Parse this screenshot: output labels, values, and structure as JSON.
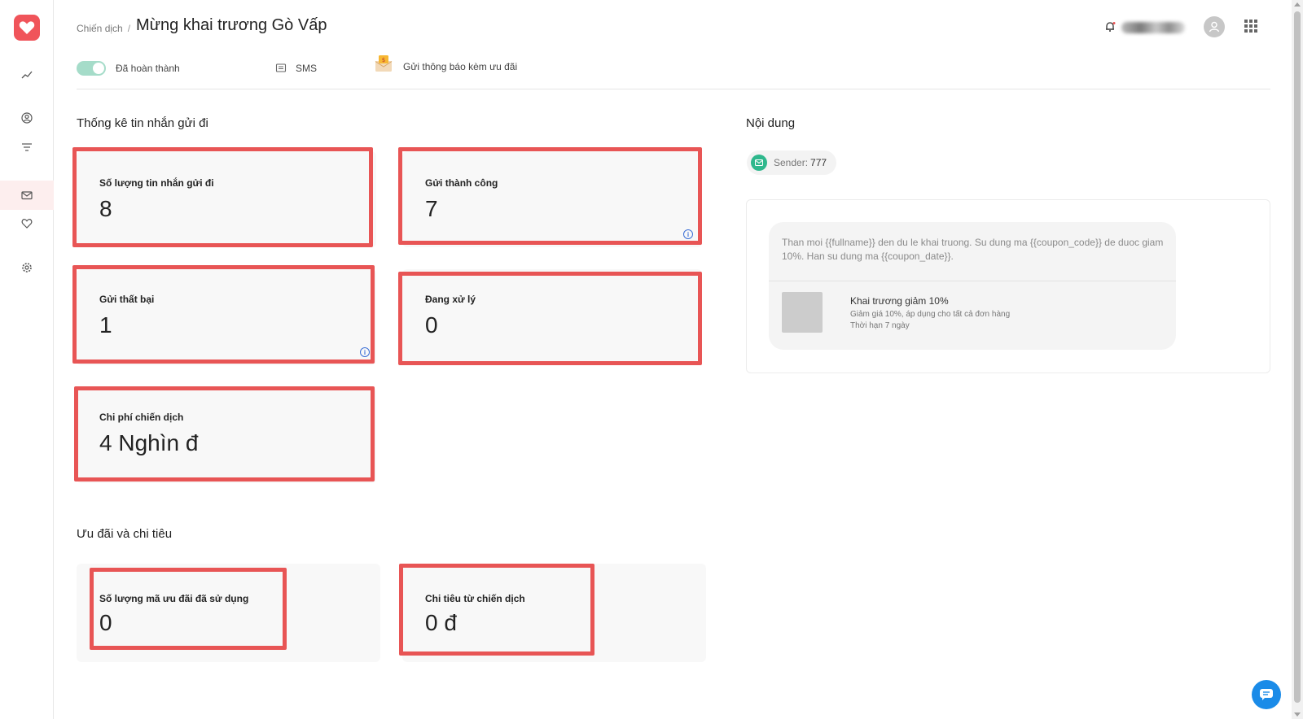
{
  "sidebar": {
    "items": [
      {
        "name": "analytics",
        "icon": "chart-line-icon"
      },
      {
        "name": "customers",
        "icon": "user-circle-icon"
      },
      {
        "name": "filters",
        "icon": "filter-icon"
      },
      {
        "name": "messages",
        "icon": "mail-icon",
        "active": true
      },
      {
        "name": "loyalty",
        "icon": "heart-icon"
      },
      {
        "name": "settings",
        "icon": "gear-icon"
      }
    ]
  },
  "header": {
    "breadcrumb": "Chiến dịch",
    "separator": "/",
    "title": "Mừng khai trương Gò Vấp"
  },
  "info_row": {
    "status_label": "Đã hoàn thành",
    "channel_label": "SMS",
    "promo_label": "Gửi thông báo kèm ưu đãi"
  },
  "stats": {
    "section_title": "Thống kê tin nhắn gửi đi",
    "cards": [
      {
        "label": "Số lượng tin nhắn gửi đi",
        "value": "8"
      },
      {
        "label": "Gửi thành công",
        "value": "7"
      },
      {
        "label": "Gửi thất bại",
        "value": "1"
      },
      {
        "label": "Đang xử lý",
        "value": "0"
      },
      {
        "label": "Chi phí chiến dịch",
        "value": "4 Nghìn đ"
      }
    ]
  },
  "offers": {
    "section_title": "Ưu đãi và chi tiêu",
    "cards": [
      {
        "label": "Số lượng mã ưu đãi đã sử dụng",
        "value": "0"
      },
      {
        "label": "Chi tiêu từ chiến dịch",
        "value": "0 đ"
      }
    ]
  },
  "content": {
    "section_title": "Nội dung",
    "sender_label": "Sender:",
    "sender_value": "777",
    "message": "Than moi {{fullname}} den du le khai truong. Su dung ma {{coupon_code}} de duoc giam 10%. Han su dung ma {{coupon_date}}.",
    "coupon": {
      "title": "Khai trương giảm 10%",
      "description": "Giảm giá 10%, áp dụng cho tất cả đơn hàng",
      "expiry": "Thời hạn 7 ngày"
    }
  },
  "colors": {
    "brand": "#f0545a",
    "highlight_border": "#e85555",
    "toggle_on": "#a5dcc9",
    "sender_icon": "#2fb88d",
    "info_icon": "#3b6fd6",
    "chat_button": "#1a8be8"
  }
}
